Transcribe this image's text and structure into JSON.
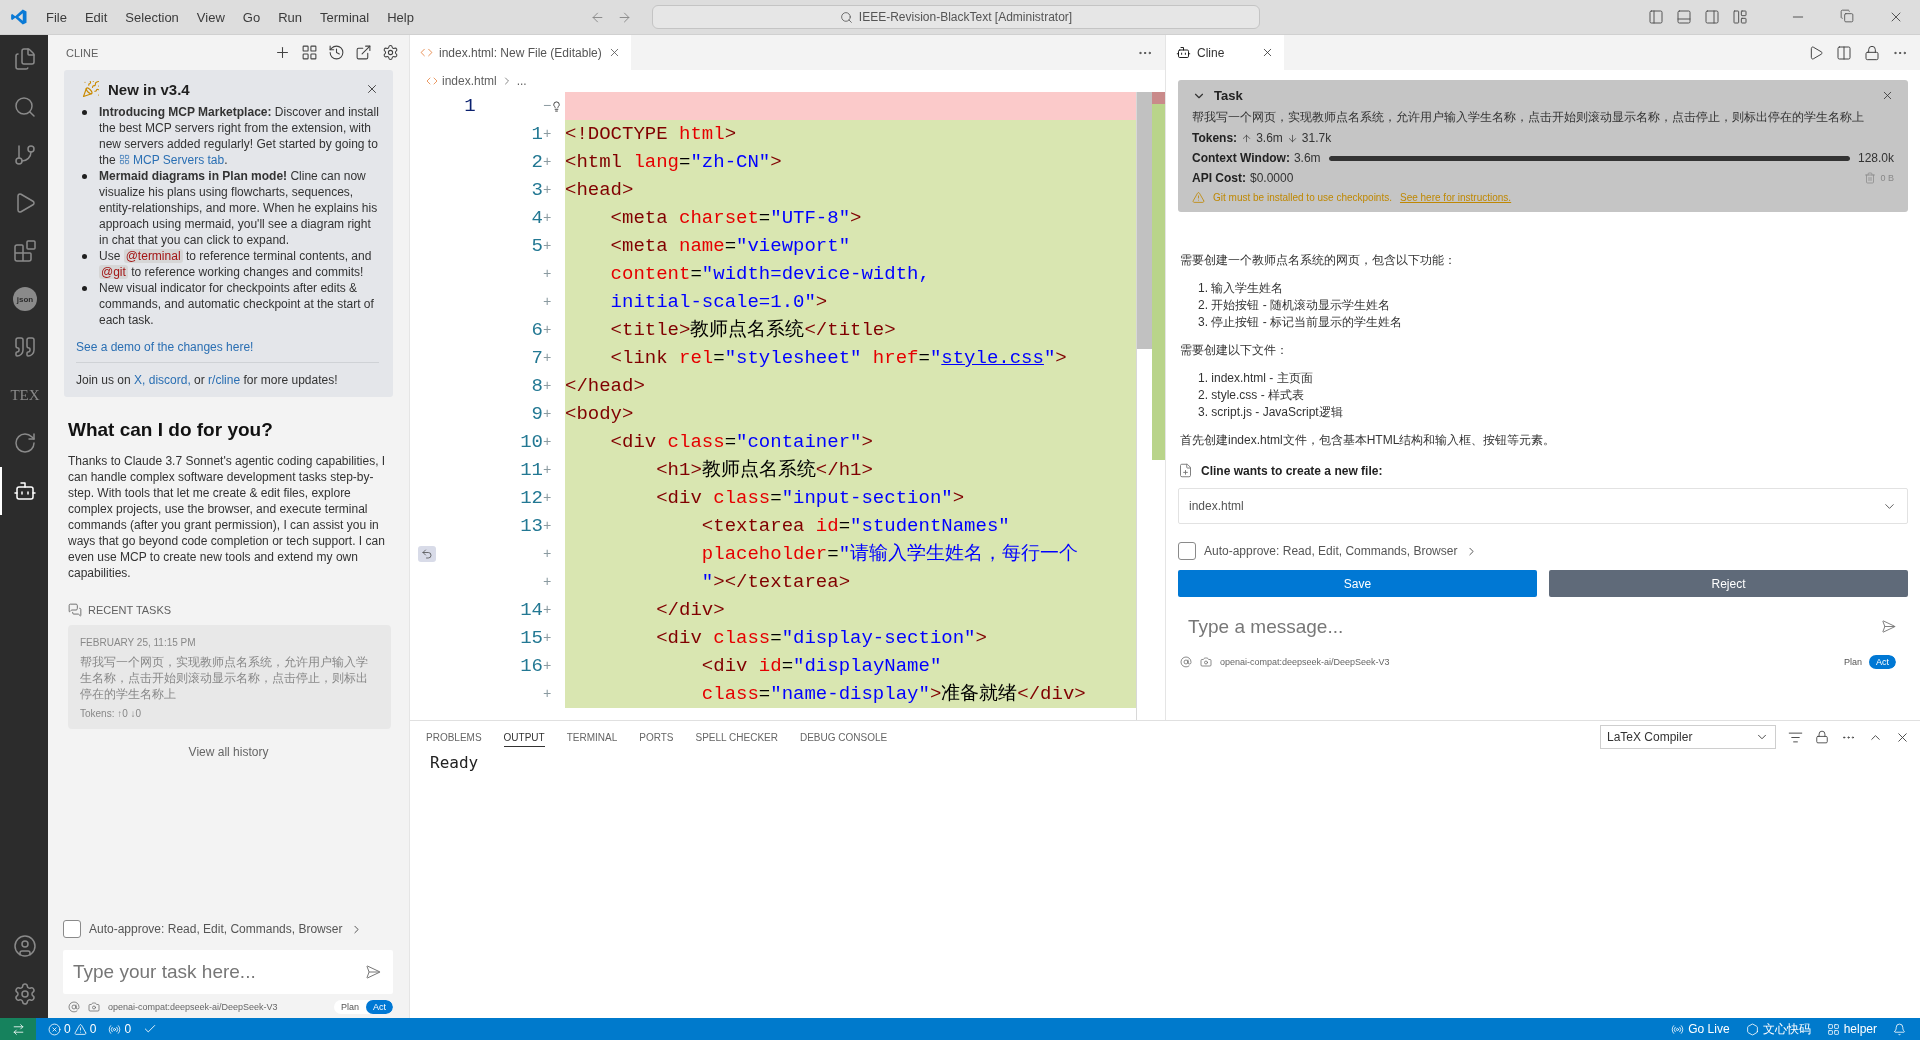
{
  "title_bar": {
    "menus": [
      "File",
      "Edit",
      "Selection",
      "View",
      "Go",
      "Run",
      "Terminal",
      "Help"
    ],
    "search": "IEEE-Revision-BlackText [Administrator]"
  },
  "activity_bar": {
    "items": [
      {
        "kind": "explorer",
        "selected": false
      },
      {
        "kind": "search",
        "selected": false
      },
      {
        "kind": "source-control",
        "selected": false
      },
      {
        "kind": "run",
        "selected": false
      },
      {
        "kind": "extensions",
        "selected": false
      },
      {
        "kind": "json",
        "label": "json",
        "selected": false
      },
      {
        "kind": "quote",
        "selected": false
      },
      {
        "kind": "tex",
        "label": "TEX",
        "selected": false
      },
      {
        "kind": "circle",
        "selected": false
      },
      {
        "kind": "cline",
        "selected": true
      }
    ],
    "bottom": [
      {
        "kind": "account"
      },
      {
        "kind": "settings"
      }
    ]
  },
  "sidebar": {
    "title": "CLINE",
    "news": {
      "title": "New in v3.4",
      "items": [
        {
          "segments": [
            {
              "kind": "bold",
              "text": "Introducing MCP Marketplace:"
            },
            {
              "kind": "text",
              "text": " Discover and install the best MCP servers right from the extension, with new servers added regularly! Get started by going to the "
            },
            {
              "kind": "icon-link",
              "text": "MCP Servers tab"
            },
            {
              "kind": "text",
              "text": "."
            }
          ]
        },
        {
          "segments": [
            {
              "kind": "bold",
              "text": "Mermaid diagrams in Plan mode!"
            },
            {
              "kind": "text",
              "text": " Cline can now visualize his plans using flowcharts, sequences, entity-relationships, and more. When he explains his approach using mermaid, you'll see a diagram right in chat that you can click to expand."
            }
          ]
        },
        {
          "segments": [
            {
              "kind": "text",
              "text": "Use "
            },
            {
              "kind": "mention",
              "text": "@terminal"
            },
            {
              "kind": "text",
              "text": " to reference terminal contents, and "
            },
            {
              "kind": "mention",
              "text": "@git"
            },
            {
              "kind": "text",
              "text": " to reference working changes and commits!"
            }
          ]
        },
        {
          "segments": [
            {
              "kind": "text",
              "text": "New visual indicator for checkpoints after edits & commands, and automatic checkpoint at the start of each task."
            }
          ]
        }
      ],
      "demo_link": "See a demo of the changes here!",
      "join": [
        {
          "kind": "text",
          "text": "Join us on "
        },
        {
          "kind": "link",
          "text": "X,"
        },
        {
          "kind": "link",
          "text": " discord,"
        },
        {
          "kind": "text",
          "text": " or "
        },
        {
          "kind": "link",
          "text": "r/cline"
        },
        {
          "kind": "text",
          "text": " for more updates!"
        }
      ]
    },
    "welcome": {
      "title": "What can I do for you?",
      "body": "Thanks to Claude 3.7 Sonnet's agentic coding capabilities, I can handle complex software development tasks step-by-step. With tools that let me create & edit files, explore complex projects, use the browser, and execute terminal commands (after you grant permission), I can assist you in ways that go beyond code completion or tech support. I can even use MCP to create new tools and extend my own capabilities."
    },
    "recent_tasks": {
      "title": "RECENT TASKS",
      "tasks": [
        {
          "date": "FEBRUARY 25, 11:15 PM",
          "text": "帮我写一个网页，实现教师点名系统，允许用户输入学生名称，点击开始则滚动显示名称，点击停止，则标出停在的学生名称上",
          "tokens": "Tokens: ↑0 ↓0"
        }
      ],
      "view_all": "View all history"
    },
    "auto_approve": {
      "label": "Auto-approve: Read, Edit, Commands, Browser",
      "checked": false
    },
    "input": {
      "placeholder": "Type your task here..."
    },
    "footer": {
      "model": "openai-compat:deepseek-ai/DeepSeek-V3",
      "modes": [
        {
          "label": "Plan",
          "selected": false
        },
        {
          "label": "Act",
          "selected": true
        }
      ]
    }
  },
  "editor": {
    "tabs": [
      {
        "label": "index.html: New File (Editable)",
        "selected": true
      }
    ],
    "breadcrumb": [
      "index.html",
      "..."
    ],
    "lines": [
      {
        "kind": "removed",
        "old": "1",
        "marker": "−",
        "lightbulb": true
      },
      {
        "kind": "added",
        "new": "1",
        "marker": "+",
        "tokens": [
          {
            "kind": "tag",
            "text": "<!DOCTYPE"
          },
          {
            "kind": "attr",
            "text": " html"
          },
          {
            "kind": "tag",
            "text": ">"
          }
        ]
      },
      {
        "kind": "added",
        "new": "2",
        "marker": "+",
        "tokens": [
          {
            "kind": "tag",
            "text": "<html"
          },
          {
            "kind": "attr",
            "text": " lang"
          },
          {
            "kind": "plain",
            "text": "="
          },
          {
            "kind": "str",
            "text": "\"zh-CN\""
          },
          {
            "kind": "tag",
            "text": ">"
          }
        ]
      },
      {
        "kind": "added",
        "new": "3",
        "marker": "+",
        "tokens": [
          {
            "kind": "tag",
            "text": "<head>"
          }
        ]
      },
      {
        "kind": "added",
        "new": "4",
        "marker": "+",
        "tokens": [
          {
            "kind": "tag",
            "text": "    <meta"
          },
          {
            "kind": "attr",
            "text": " charset"
          },
          {
            "kind": "plain",
            "text": "="
          },
          {
            "kind": "str",
            "text": "\"UTF-8\""
          },
          {
            "kind": "tag",
            "text": ">"
          }
        ]
      },
      {
        "kind": "added",
        "new": "5",
        "marker": "+",
        "tokens": [
          {
            "kind": "tag",
            "text": "    <meta"
          },
          {
            "kind": "attr",
            "text": " name"
          },
          {
            "kind": "plain",
            "text": "="
          },
          {
            "kind": "str",
            "text": "\"viewport\""
          }
        ]
      },
      {
        "kind": "added",
        "marker": "+",
        "tokens": [
          {
            "kind": "attr",
            "text": "    content"
          },
          {
            "kind": "plain",
            "text": "="
          },
          {
            "kind": "str",
            "text": "\"width=device-width,"
          }
        ]
      },
      {
        "kind": "added",
        "marker": "+",
        "tokens": [
          {
            "kind": "str",
            "text": "    initial-scale=1.0\""
          },
          {
            "kind": "tag",
            "text": ">"
          }
        ]
      },
      {
        "kind": "added",
        "new": "6",
        "marker": "+",
        "tokens": [
          {
            "kind": "tag",
            "text": "    <title>"
          },
          {
            "kind": "plain",
            "text": "教师点名系统"
          },
          {
            "kind": "tag",
            "text": "</title>"
          }
        ]
      },
      {
        "kind": "added",
        "new": "7",
        "marker": "+",
        "tokens": [
          {
            "kind": "tag",
            "text": "    <link"
          },
          {
            "kind": "attr",
            "text": " rel"
          },
          {
            "kind": "plain",
            "text": "="
          },
          {
            "kind": "str",
            "text": "\"stylesheet\""
          },
          {
            "kind": "attr",
            "text": " href"
          },
          {
            "kind": "plain",
            "text": "="
          },
          {
            "kind": "str",
            "text": "\""
          },
          {
            "kind": "link",
            "text": "style.css"
          },
          {
            "kind": "str",
            "text": "\""
          },
          {
            "kind": "tag",
            "text": ">"
          }
        ]
      },
      {
        "kind": "added",
        "new": "8",
        "marker": "+",
        "tokens": [
          {
            "kind": "tag",
            "text": "</head>"
          }
        ]
      },
      {
        "kind": "added",
        "new": "9",
        "marker": "+",
        "tokens": [
          {
            "kind": "tag",
            "text": "<body>"
          }
        ]
      },
      {
        "kind": "added",
        "new": "10",
        "marker": "+",
        "tokens": [
          {
            "kind": "tag",
            "text": "    <div"
          },
          {
            "kind": "attr",
            "text": " class"
          },
          {
            "kind": "plain",
            "text": "="
          },
          {
            "kind": "str",
            "text": "\"container\""
          },
          {
            "kind": "tag",
            "text": ">"
          }
        ]
      },
      {
        "kind": "added",
        "new": "11",
        "marker": "+",
        "tokens": [
          {
            "kind": "tag",
            "text": "        <h1>"
          },
          {
            "kind": "plain",
            "text": "教师点名系统"
          },
          {
            "kind": "tag",
            "text": "</h1>"
          }
        ]
      },
      {
        "kind": "added",
        "new": "12",
        "marker": "+",
        "tokens": [
          {
            "kind": "tag",
            "text": "        <div"
          },
          {
            "kind": "attr",
            "text": " class"
          },
          {
            "kind": "plain",
            "text": "="
          },
          {
            "kind": "str",
            "text": "\"input-section\""
          },
          {
            "kind": "tag",
            "text": ">"
          }
        ]
      },
      {
        "kind": "added",
        "new": "13",
        "marker": "+",
        "tokens": [
          {
            "kind": "tag",
            "text": "            <textarea"
          },
          {
            "kind": "attr",
            "text": " id"
          },
          {
            "kind": "plain",
            "text": "="
          },
          {
            "kind": "str",
            "text": "\"studentNames\""
          }
        ]
      },
      {
        "kind": "added",
        "marker": "+",
        "revert_button": true,
        "tokens": [
          {
            "kind": "attr",
            "text": "            placeholder"
          },
          {
            "kind": "plain",
            "text": "="
          },
          {
            "kind": "str",
            "text": "\"请输入学生姓名，每行一个"
          }
        ]
      },
      {
        "kind": "added",
        "marker": "+",
        "tokens": [
          {
            "kind": "str",
            "text": "            \""
          },
          {
            "kind": "tag",
            "text": "></textarea>"
          }
        ]
      },
      {
        "kind": "added",
        "new": "14",
        "marker": "+",
        "tokens": [
          {
            "kind": "tag",
            "text": "        </div>"
          }
        ]
      },
      {
        "kind": "added",
        "new": "15",
        "marker": "+",
        "tokens": [
          {
            "kind": "tag",
            "text": "        <div"
          },
          {
            "kind": "attr",
            "text": " class"
          },
          {
            "kind": "plain",
            "text": "="
          },
          {
            "kind": "str",
            "text": "\"display-section\""
          },
          {
            "kind": "tag",
            "text": ">"
          }
        ]
      },
      {
        "kind": "added",
        "new": "16",
        "marker": "+",
        "tokens": [
          {
            "kind": "tag",
            "text": "            <div"
          },
          {
            "kind": "attr",
            "text": " id"
          },
          {
            "kind": "plain",
            "text": "="
          },
          {
            "kind": "str",
            "text": "\"displayName\""
          }
        ]
      },
      {
        "kind": "added",
        "marker": "+",
        "tokens": [
          {
            "kind": "attr",
            "text": "            class"
          },
          {
            "kind": "plain",
            "text": "="
          },
          {
            "kind": "str",
            "text": "\"name-display\""
          },
          {
            "kind": "tag",
            "text": ">"
          },
          {
            "kind": "plain",
            "text": "准备就绪"
          },
          {
            "kind": "tag",
            "text": "</div>"
          }
        ]
      }
    ]
  },
  "cline": {
    "tab": {
      "label": "Cline",
      "selected": true
    },
    "task": {
      "title": "Task",
      "expanded": true,
      "text": "帮我写一个网页，实现教师点名系统，允许用户输入学生名称，点击开始则滚动显示名称，点击停止，则标出停在的学生名称上",
      "tokens_label": "Tokens:",
      "tokens_in": "3.6m",
      "tokens_out": "31.7k",
      "context": {
        "label": "Context Window:",
        "used": "3.6m",
        "max": "128.0k",
        "level": 1
      },
      "cost_label": "API Cost:",
      "cost": "$0.0000",
      "size": "0 B",
      "warning": "Git must be installed to use checkpoints.",
      "warning_link": "See here for instructions."
    },
    "message": [
      {
        "kind": "paragraph",
        "text": "需要创建一个教师点名系统的网页，包含以下功能："
      },
      {
        "kind": "list",
        "items": [
          "1. 输入学生姓名",
          "2. 开始按钮 - 随机滚动显示学生姓名",
          "3. 停止按钮 - 标记当前显示的学生姓名"
        ]
      },
      {
        "kind": "paragraph",
        "text": "需要创建以下文件："
      },
      {
        "kind": "list",
        "items": [
          "1. index.html - 主页面",
          "2. style.css - 样式表",
          "3. script.js - JavaScript逻辑"
        ]
      },
      {
        "kind": "paragraph",
        "text": "首先创建index.html文件，包含基本HTML结构和输入框、按钮等元素。"
      }
    ],
    "tool": {
      "title": "Cline wants to create a new file:",
      "file": "index.html"
    },
    "auto_approve": {
      "label": "Auto-approve: Read, Edit, Commands, Browser",
      "checked": false
    },
    "buttons": [
      {
        "kind": "primary",
        "label": "Save"
      },
      {
        "kind": "secondary",
        "label": "Reject"
      }
    ],
    "input": {
      "placeholder": "Type a message..."
    },
    "footer": {
      "model": "openai-compat:deepseek-ai/DeepSeek-V3",
      "modes": [
        {
          "label": "Plan",
          "selected": false
        },
        {
          "label": "Act",
          "selected": true
        }
      ]
    }
  },
  "panel": {
    "tabs": [
      {
        "label": "PROBLEMS",
        "selected": false
      },
      {
        "label": "OUTPUT",
        "selected": true
      },
      {
        "label": "TERMINAL",
        "selected": false
      },
      {
        "label": "PORTS",
        "selected": false
      },
      {
        "label": "SPELL CHECKER",
        "selected": false
      },
      {
        "label": "DEBUG CONSOLE",
        "selected": false
      }
    ],
    "channel": "LaTeX Compiler",
    "output": "Ready"
  },
  "status_bar": {
    "errors": "0",
    "warnings": "0",
    "ports": "0",
    "right": [
      {
        "kind": "golive",
        "label": "Go Live"
      },
      {
        "kind": "wenxin",
        "label": "文心快码"
      },
      {
        "kind": "helper",
        "label": "helper"
      },
      {
        "kind": "bell"
      }
    ]
  }
}
